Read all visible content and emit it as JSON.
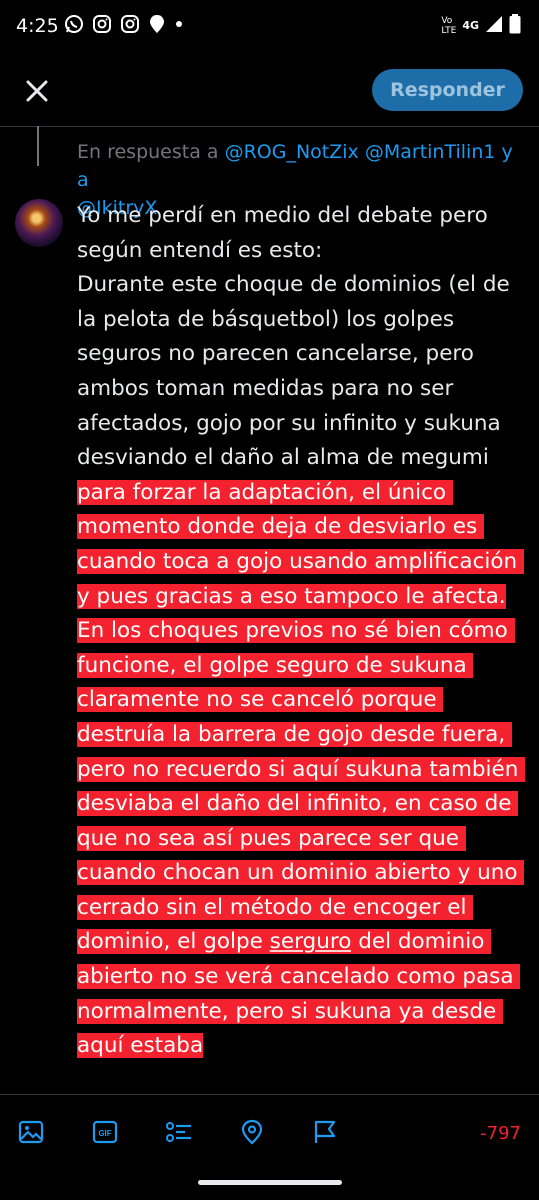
{
  "status_bar": {
    "time": "4:25",
    "network": "4G",
    "volte_top": "Vo",
    "volte_bottom": "LTE"
  },
  "header": {
    "reply_button_label": "Responder"
  },
  "reply_context": {
    "prefix": "En respuesta a ",
    "mention1": "@ROG_NotZix",
    "mention2": "@MartinTilin1",
    "joiner": " y a",
    "mention3": "@IkitryX"
  },
  "compose": {
    "plain": "Yo me perdí en medio del debate pero según entendí es esto:\nDurante este choque de dominios (el de la pelota de básquetbol) los golpes seguros no parecen cancelarse, pero ambos toman medidas para no ser afectados, gojo por su infinito y sukuna desviando el daño al alma de megumi ",
    "overflow_a": "para forzar la adaptación, el único momento donde deja de desviarlo es cuando toca a gojo usando amplificación y pues gracias a eso tampoco le afecta.\nEn los choques previos no sé bien cómo funcione, el golpe seguro de sukuna claramente no se canceló porque destruía la barrera de gojo desde fuera, pero no recuerdo si aquí sukuna también desviaba el daño del infinito, en caso de que no sea así pues parece ser que cuando chocan un dominio abierto y uno cerrado sin el método de encoger el dominio, el golpe ",
    "misspelled": "serguro",
    "overflow_b": " del dominio abierto no se verá cancelado como pasa normalmente, pero si sukuna ya desde aquí estaba"
  },
  "toolbar": {
    "icons": [
      "image-icon",
      "gif-icon",
      "poll-icon",
      "location-icon",
      "flag-icon"
    ],
    "char_count": "-797"
  },
  "colors": {
    "accent": "#1d9bf0",
    "overflow_highlight": "#f4212e",
    "reply_button_bg": "#1d6ea8"
  }
}
